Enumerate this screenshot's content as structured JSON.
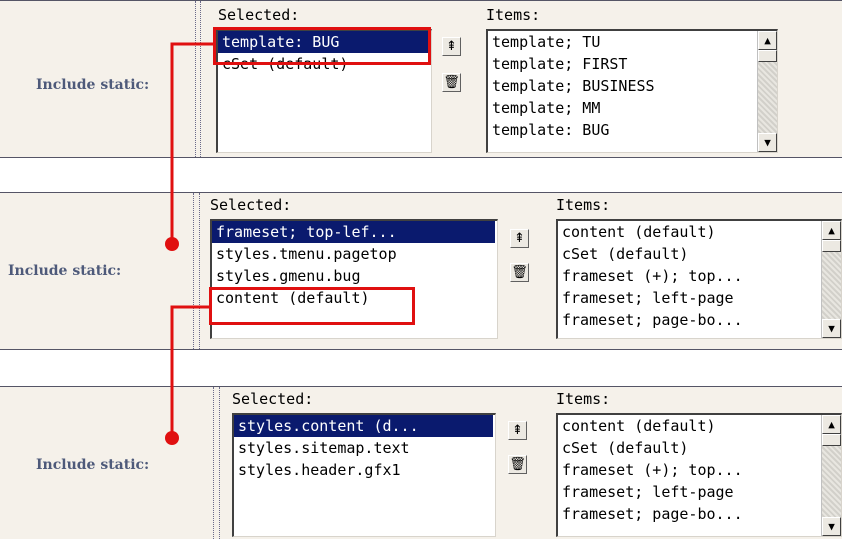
{
  "accent_color": "#e01010",
  "selection_color": "#0a1a6e",
  "panels": [
    {
      "label": "Include static:",
      "selected_caption": "Selected:",
      "items_caption": "Items:",
      "selected": [
        "template: BUG",
        "cSet (default)"
      ],
      "items": [
        "template; TU",
        "template; FIRST",
        "template; BUSINESS",
        "template; MM",
        "template: BUG"
      ]
    },
    {
      "label": "Include static:",
      "selected_caption": "Selected:",
      "items_caption": "Items:",
      "selected": [
        "frameset; top-lef...",
        "styles.tmenu.pagetop",
        "styles.gmenu.bug",
        "content (default)"
      ],
      "items": [
        "content (default)",
        "cSet (default)",
        "frameset (+); top...",
        "frameset; left-page",
        "frameset; page-bo..."
      ]
    },
    {
      "label": "Include static:",
      "selected_caption": "Selected:",
      "items_caption": "Items:",
      "selected": [
        "styles.content (d...",
        "styles.sitemap.text",
        "styles.header.gfx1"
      ],
      "items": [
        "content (default)",
        "cSet (default)",
        "frameset (+); top...",
        "frameset; left-page",
        "frameset; page-bo..."
      ]
    }
  ],
  "icons": {
    "move_top": "move-to-top-icon",
    "delete": "trash-icon",
    "scroll_up": "scroll-up-arrow-icon",
    "scroll_down": "scroll-down-arrow-icon"
  }
}
